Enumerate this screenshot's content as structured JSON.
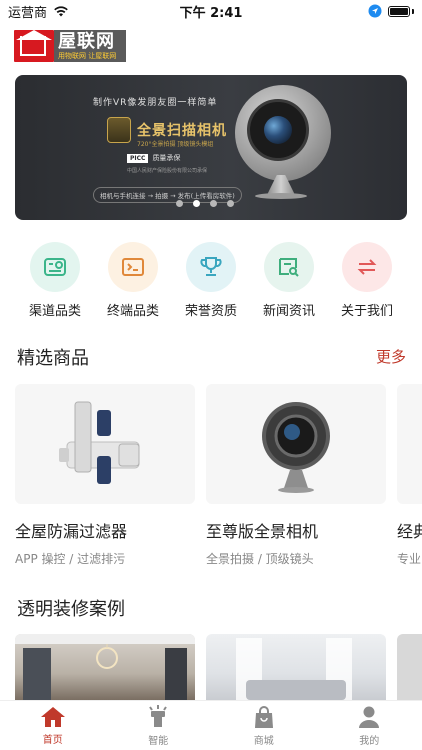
{
  "status_bar": {
    "carrier": "运营商",
    "time": "下午 2:41"
  },
  "logo": {
    "title": "屋联网",
    "subtitle": "用物联网  让屋联网"
  },
  "banner": {
    "line1": "制作VR像发朋友圈一样简单",
    "title": "全景扫描相机",
    "spec": "720°全景拍摄  顶级镜头模组",
    "picc_brand": "PICC",
    "picc_text": "质量承保",
    "picc_small": "中国人民财产保险股份有限公司承保",
    "steps": "相机与手机连接 → 拍摄 → 发布(上传看房软件)",
    "dots_count": 4,
    "active_dot": 1
  },
  "categories": [
    {
      "label": "渠道品类",
      "icon": "channel-icon",
      "bg": "#e3f5ef",
      "color": "#3bb58a"
    },
    {
      "label": "终端品类",
      "icon": "terminal-icon",
      "bg": "#fdf1e2",
      "color": "#e0883a"
    },
    {
      "label": "荣誉资质",
      "icon": "trophy-icon",
      "bg": "#e2f3f6",
      "color": "#3aa6bf"
    },
    {
      "label": "新闻资讯",
      "icon": "news-icon",
      "bg": "#e6f4ee",
      "color": "#3fae7d"
    },
    {
      "label": "关于我们",
      "icon": "about-icon",
      "bg": "#fde7e7",
      "color": "#e15858"
    }
  ],
  "featured": {
    "title": "精选商品",
    "more": "更多",
    "products": [
      {
        "name": "全屋防漏过滤器",
        "desc": "APP 操控 / 过滤排污"
      },
      {
        "name": "至尊版全景相机",
        "desc": "全景拍摄 / 顶级镜头"
      },
      {
        "name": "经典",
        "desc": "专业"
      }
    ]
  },
  "cases": {
    "title": "透明装修案例"
  },
  "tabbar": [
    {
      "label": "首页",
      "icon": "home-icon",
      "active": true
    },
    {
      "label": "智能",
      "icon": "smart-light-icon",
      "active": false
    },
    {
      "label": "商城",
      "icon": "shopping-bag-icon",
      "active": false
    },
    {
      "label": "我的",
      "icon": "user-icon",
      "active": false
    }
  ],
  "colors": {
    "accent": "#c0392b",
    "brand_red": "#d71920"
  }
}
